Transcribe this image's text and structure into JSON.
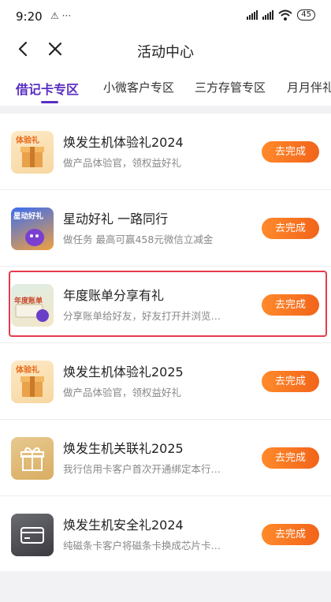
{
  "status_bar": {
    "time": "9:20",
    "left_icons": "⚠ ···",
    "battery": "45"
  },
  "header": {
    "title": "活动中心"
  },
  "tabs": [
    {
      "label": "借记卡专区",
      "active": true
    },
    {
      "label": "小微客户专区",
      "active": false
    },
    {
      "label": "三方存管专区",
      "active": false
    },
    {
      "label": "月月伴礼",
      "active": false
    }
  ],
  "items": [
    {
      "title": "焕发生机体验礼2024",
      "desc": "做产品体验官，领权益好礼",
      "button": "去完成",
      "thumb_text": "体验礼",
      "thumb_icon": "gift-box-icon"
    },
    {
      "title": "星动好礼 一路同行",
      "desc": "做任务 最高可赢458元微信立减金",
      "button": "去完成",
      "thumb_text": "星动好礼",
      "thumb_icon": "mascot-icon"
    },
    {
      "title": "年度账单分享有礼",
      "desc": "分享账单给好友，好友打开并浏览…",
      "button": "去完成",
      "thumb_text": "年度账单",
      "thumb_icon": "annual-bill-icon"
    },
    {
      "title": "焕发生机体验礼2025",
      "desc": "做产品体验官，领权益好礼",
      "button": "去完成",
      "thumb_text": "体验礼",
      "thumb_icon": "gift-box-icon"
    },
    {
      "title": "焕发生机关联礼2025",
      "desc": "我行信用卡客户首次开通绑定本行…",
      "button": "去完成",
      "thumb_text": "",
      "thumb_icon": "gift-icon"
    },
    {
      "title": "焕发生机安全礼2024",
      "desc": "纯磁条卡客户将磁条卡换成芯片卡…",
      "button": "去完成",
      "thumb_text": "",
      "thumb_icon": "card-icon"
    }
  ],
  "colors": {
    "accent": "#5a2fc2",
    "button": "#f2641a",
    "highlight": "#e53a4c"
  }
}
